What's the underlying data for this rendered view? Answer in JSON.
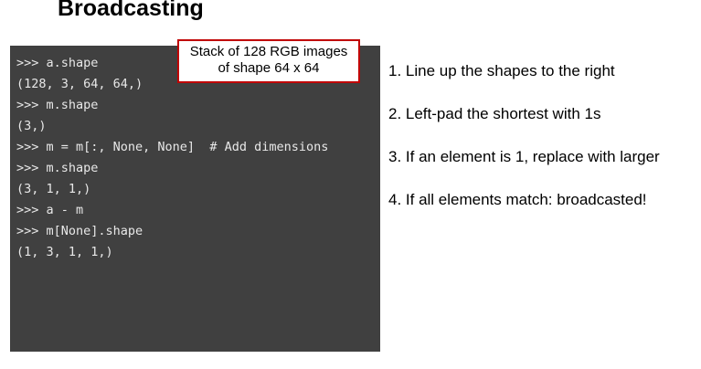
{
  "title": "Broadcasting",
  "code_lines": [
    ">>> a.shape",
    "(128, 3, 64, 64,)",
    ">>> m.shape",
    "(3,)",
    ">>> m = m[:, None, None]  # Add dimensions",
    ">>> m.shape",
    "(3, 1, 1,)",
    ">>> a - m",
    ">>> m[None].shape",
    "(1, 3, 1, 1,)"
  ],
  "callout": {
    "line1": "Stack of 128 RGB images",
    "line2": "of shape 64 x 64"
  },
  "steps": [
    "1. Line up the shapes to the right",
    "2. Left-pad the shortest with 1s",
    "3. If an element is 1, replace with larger",
    "4. If all elements match: broadcasted!"
  ],
  "colors": {
    "code_background": "#404040",
    "code_text": "#e8e8e8",
    "callout_border": "#c00000"
  }
}
